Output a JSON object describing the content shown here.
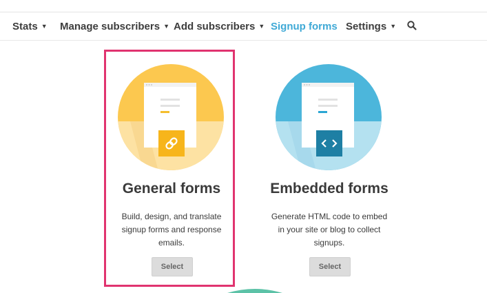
{
  "nav": {
    "items": [
      {
        "label": "Stats",
        "caret": "▼"
      },
      {
        "label": "Manage subscribers",
        "caret": "▼"
      },
      {
        "label": "Add subscribers",
        "caret": "▼"
      },
      {
        "label": "Signup forms",
        "caret": ""
      },
      {
        "label": "Settings",
        "caret": "▼"
      }
    ],
    "active": "Signup forms",
    "search_icon": "search-icon"
  },
  "cards": [
    {
      "title": "General forms",
      "description": "Build, design, and translate signup forms and response emails.",
      "button": "Select",
      "icon": "link-icon",
      "color": "#f9c74f"
    },
    {
      "title": "Embedded forms",
      "description": "Generate HTML code to embed in your site or blog to collect signups.",
      "button": "Select",
      "icon": "code-icon",
      "color": "#4fb3d9"
    }
  ],
  "colors": {
    "accent": "#3fa9d6",
    "highlight": "#e0336f"
  }
}
